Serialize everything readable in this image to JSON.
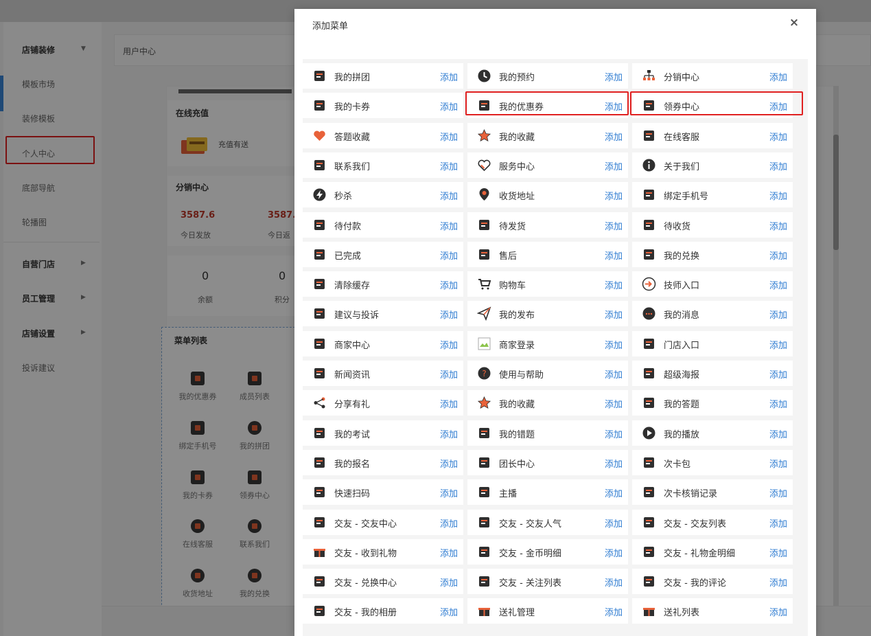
{
  "sidebar": {
    "groups": [
      {
        "label": "店铺装修",
        "items": [
          "模板市场",
          "装修模板",
          "个人中心",
          "底部导航",
          "轮播图"
        ]
      },
      {
        "label": "自营门店"
      },
      {
        "label": "员工管理"
      },
      {
        "label": "店铺设置"
      }
    ],
    "extra": "投诉建议"
  },
  "breadcrumb": "用户中心",
  "preview": {
    "recharge_title": "在线充值",
    "recharge_text": "充值有送",
    "distribution_title": "分销中心",
    "dist_value_1": "3587.6",
    "dist_label_1": "今日发放",
    "dist_value_2": "3587.",
    "dist_label_2": "今日返",
    "balance_value": "0",
    "balance_label": "余额",
    "points_value": "0",
    "points_label": "积分",
    "menu_list_title": "菜单列表",
    "menu_list_items": [
      "我的优惠券",
      "成员列表",
      "绑定手机号",
      "我的拼团",
      "我的卡券",
      "领券中心",
      "在线客服",
      "联系我们",
      "收货地址",
      "我的兑换"
    ]
  },
  "modal": {
    "title": "添加菜单",
    "close": "×",
    "add_label": "添加",
    "items": [
      {
        "label": "我的拼团",
        "icon": "group-buy-icon"
      },
      {
        "label": "我的预约",
        "icon": "clock-icon"
      },
      {
        "label": "分销中心",
        "icon": "org-chart-icon"
      },
      {
        "label": "我的卡券",
        "icon": "card-icon"
      },
      {
        "label": "我的优惠券",
        "icon": "coupon-icon"
      },
      {
        "label": "领券中心",
        "icon": "coupon-center-icon"
      },
      {
        "label": "答题收藏",
        "icon": "heart-icon"
      },
      {
        "label": "我的收藏",
        "icon": "star-icon"
      },
      {
        "label": "在线客服",
        "icon": "headset-icon"
      },
      {
        "label": "联系我们",
        "icon": "phone-icon"
      },
      {
        "label": "服务中心",
        "icon": "heart-outline-icon"
      },
      {
        "label": "关于我们",
        "icon": "info-icon"
      },
      {
        "label": "秒杀",
        "icon": "flash-icon"
      },
      {
        "label": "收货地址",
        "icon": "location-icon"
      },
      {
        "label": "绑定手机号",
        "icon": "mobile-icon"
      },
      {
        "label": "待付款",
        "icon": "wallet-icon"
      },
      {
        "label": "待发货",
        "icon": "truck-icon"
      },
      {
        "label": "待收货",
        "icon": "receive-icon"
      },
      {
        "label": "已完成",
        "icon": "done-box-icon"
      },
      {
        "label": "售后",
        "icon": "after-sale-icon"
      },
      {
        "label": "我的兑换",
        "icon": "exchange-icon"
      },
      {
        "label": "清除缓存",
        "icon": "brush-icon"
      },
      {
        "label": "购物车",
        "icon": "cart-icon"
      },
      {
        "label": "技师入口",
        "icon": "login-icon"
      },
      {
        "label": "建议与投诉",
        "icon": "edit-icon"
      },
      {
        "label": "我的发布",
        "icon": "send-icon"
      },
      {
        "label": "我的消息",
        "icon": "message-icon"
      },
      {
        "label": "商家中心",
        "icon": "shop-icon"
      },
      {
        "label": "商家登录",
        "icon": "broken-image-icon"
      },
      {
        "label": "门店入口",
        "icon": "door-icon"
      },
      {
        "label": "新闻资讯",
        "icon": "news-icon"
      },
      {
        "label": "使用与帮助",
        "icon": "help-icon"
      },
      {
        "label": "超级海报",
        "icon": "poster-icon"
      },
      {
        "label": "分享有礼",
        "icon": "share-icon"
      },
      {
        "label": "我的收藏",
        "icon": "star-icon"
      },
      {
        "label": "我的答题",
        "icon": "answer-icon"
      },
      {
        "label": "我的考试",
        "icon": "exam-icon"
      },
      {
        "label": "我的错题",
        "icon": "wrong-icon"
      },
      {
        "label": "我的播放",
        "icon": "play-icon"
      },
      {
        "label": "我的报名",
        "icon": "signup-icon"
      },
      {
        "label": "团长中心",
        "icon": "leader-icon"
      },
      {
        "label": "次卡包",
        "icon": "card-pack-icon"
      },
      {
        "label": "快速扫码",
        "icon": "scan-icon"
      },
      {
        "label": "主播",
        "icon": "anchor-icon"
      },
      {
        "label": "次卡核销记录",
        "icon": "record-icon"
      },
      {
        "label": "交友 - 交友中心",
        "icon": "friends-icon"
      },
      {
        "label": "交友 - 交友人气",
        "icon": "doc-icon"
      },
      {
        "label": "交友 - 交友列表",
        "icon": "person-icon"
      },
      {
        "label": "交友 - 收到礼物",
        "icon": "gift-icon"
      },
      {
        "label": "交友 - 金币明细",
        "icon": "doc-icon"
      },
      {
        "label": "交友 - 礼物金明细",
        "icon": "doc-icon"
      },
      {
        "label": "交友 - 兑换中心",
        "icon": "doc-box-icon"
      },
      {
        "label": "交友 - 关注列表",
        "icon": "doc-box-icon"
      },
      {
        "label": "交友 - 我的评论",
        "icon": "doc-box-icon"
      },
      {
        "label": "交友 - 我的相册",
        "icon": "doc-box-icon"
      },
      {
        "label": "送礼管理",
        "icon": "gift-icon"
      },
      {
        "label": "送礼列表",
        "icon": "gift-icon"
      }
    ]
  },
  "colors": {
    "accent": "#2d7bd1",
    "highlight": "#e02020",
    "icon_dark": "#2f2f2f",
    "icon_orange": "#e8623a"
  }
}
